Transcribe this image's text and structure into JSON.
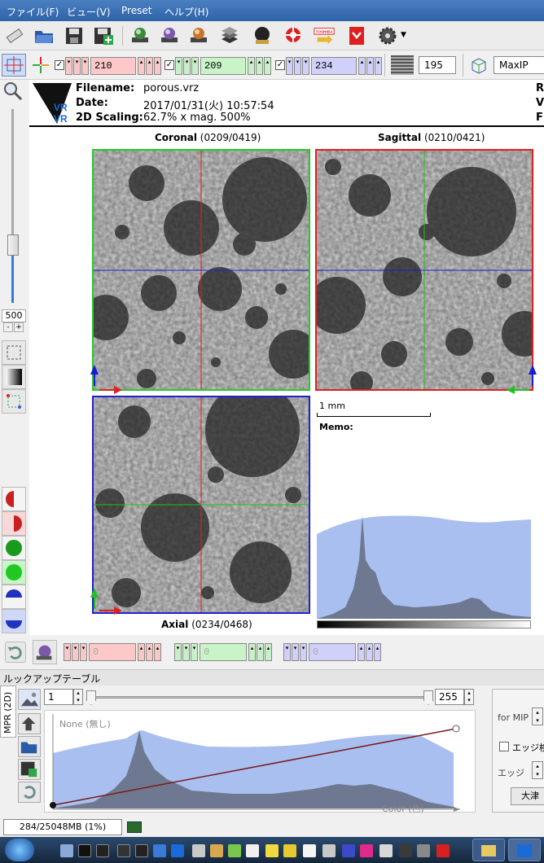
{
  "menu": [
    "ファイル(F)",
    "ビュー(V)",
    "Preset",
    "ヘルプ(H)"
  ],
  "toolbar": {
    "icons": [
      "eraser-icon",
      "open-folder-icon",
      "save-icon",
      "save-plus-icon",
      "render-icon-1",
      "render-icon-2",
      "render-icon-3",
      "stack-icon",
      "head-icon",
      "lifebuoy-icon",
      "toshiba-icon",
      "bookmark-icon",
      "gear-icon"
    ],
    "toshiba_label": "TOSHIBA"
  },
  "controls": {
    "red_value": "210",
    "green_value": "209",
    "blue_value": "234",
    "thickness_value": "195",
    "render_mode": "MaxIP"
  },
  "left": {
    "zoom_value": "500",
    "zoom_minus": "-",
    "zoom_plus": "+"
  },
  "info": {
    "filename_label": "Filename:",
    "filename": "porous.vrz",
    "date_label": "Date:",
    "date": "2017/01/31(火) 10:57:54",
    "scaling_label": "2D Scaling:",
    "scaling": "62.7% x mag. 500%",
    "right_r": "R",
    "right_v": "V",
    "right_f": "F",
    "logo_vr1": "VR",
    "logo_vr2": "VR"
  },
  "views": {
    "coronal": {
      "name": "Coronal",
      "slice": "(0209/0419)"
    },
    "sagittal": {
      "name": "Sagittal",
      "slice": "(0210/0421)"
    },
    "axial": {
      "name": "Axial",
      "slice": "(0234/0468)"
    },
    "scale_label": "1 mm",
    "memo_label": "Memo:"
  },
  "bottom": {
    "red_value": "0",
    "green_value": "0",
    "blue_value": "0"
  },
  "lut": {
    "title": "ルックアップテーブル",
    "tab_label": "MPR (2D)",
    "min_value": "1",
    "max_value": "255",
    "none_label": "None (無し)",
    "color_label": "Color (色)",
    "for_mip_label": "for MIP",
    "edge_check_label": "エッジ検",
    "edge_label": "エッジ",
    "otsu_label": "大津"
  },
  "status": {
    "memory": "284/25048MB (1%)"
  },
  "colors": {
    "menubar": "#2e63a8",
    "coronal_border": "#28c828",
    "sagittal_border": "#e02020",
    "axial_border": "#2020d0",
    "histogram_fill": "#a8bff0"
  }
}
